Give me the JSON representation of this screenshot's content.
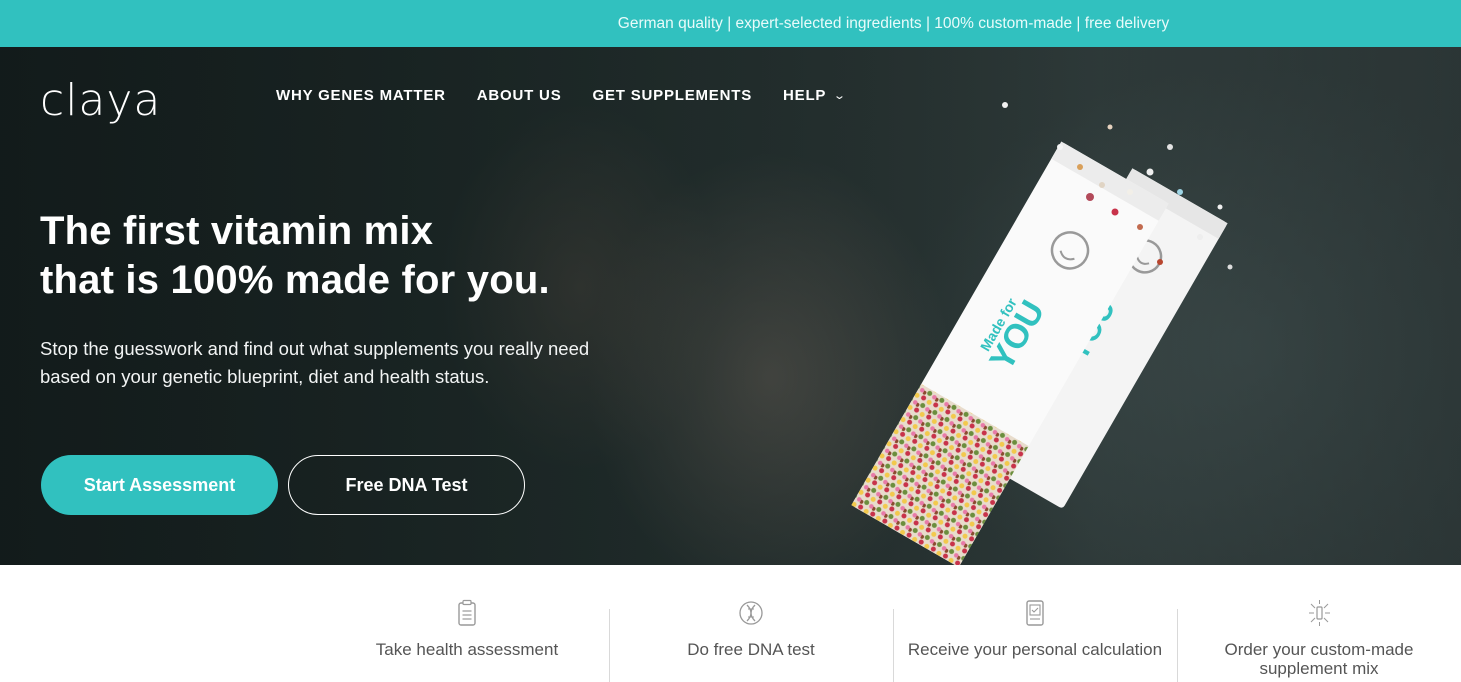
{
  "topbar": {
    "text": "German quality | expert-selected ingredients | 100% custom-made | free delivery",
    "color": "#31c1bf"
  },
  "brand": {
    "logo_text": "claya"
  },
  "nav": {
    "items": [
      {
        "label": "WHY GENES MATTER"
      },
      {
        "label": "ABOUT US"
      },
      {
        "label": "GET SUPPLEMENTS"
      },
      {
        "label": "HELP",
        "icon": "chevron-down-icon"
      }
    ]
  },
  "hero": {
    "headline_line1": "The first vitamin mix",
    "headline_line2": "that is 100% made for you.",
    "subtext_line1": "Stop the guesswork and find out what supplements you really need",
    "subtext_line2": "based on your genetic blueprint, diet and health status.",
    "primary_button": "Start Assessment",
    "secondary_button": "Free DNA Test",
    "pack_text_small": "Made for",
    "pack_text_big": "YOU",
    "pack_text_big_2": "YOU"
  },
  "steps": [
    {
      "label": "Take health assessment",
      "icon": "clipboard-icon"
    },
    {
      "label": "Do free DNA test",
      "icon": "dna-icon"
    },
    {
      "label": "Receive your personal calculation",
      "icon": "report-icon"
    },
    {
      "label": "Order your custom-made supplement mix",
      "icon": "sparkle-pack-icon"
    }
  ]
}
